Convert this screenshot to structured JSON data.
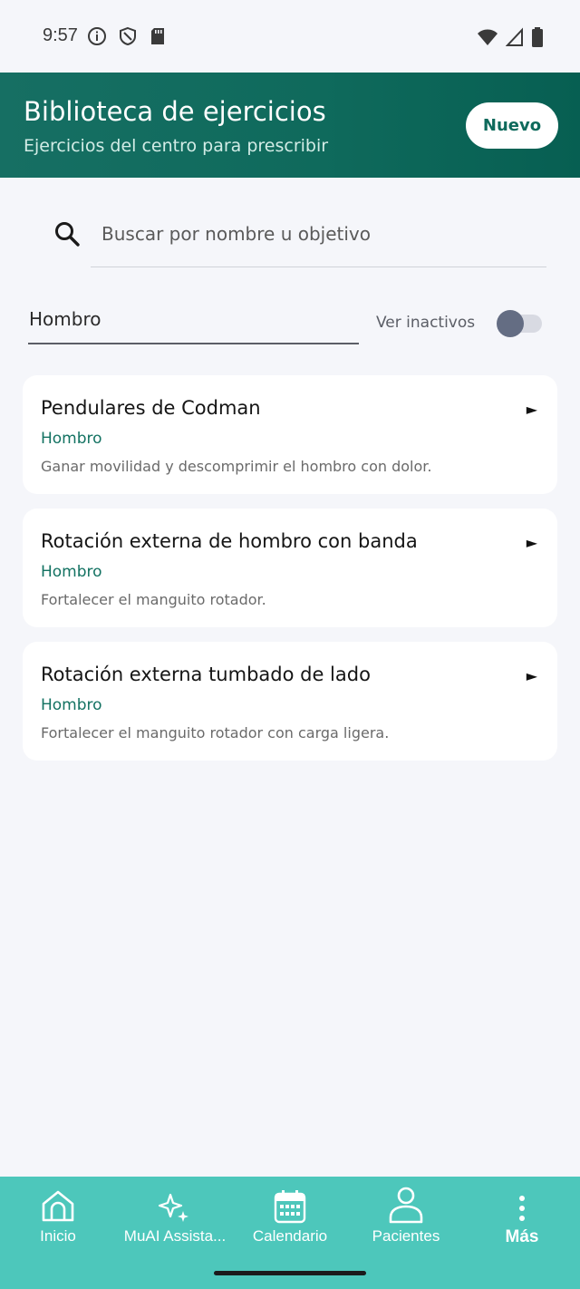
{
  "status_bar": {
    "time": "9:57",
    "left_icons": [
      "info-icon",
      "shield-icon",
      "sd-card-icon"
    ],
    "right_icons": [
      "wifi-icon",
      "signal-icon",
      "battery-icon"
    ]
  },
  "header": {
    "title": "Biblioteca de ejercicios",
    "subtitle": "Ejercicios del centro para prescribir",
    "new_button_label": "Nuevo",
    "color": "#0f6a5c"
  },
  "search": {
    "placeholder": "Buscar por nombre u objetivo",
    "value": ""
  },
  "filter": {
    "value": "Hombro",
    "inactive_label": "Ver inactivos",
    "inactive_toggle_on": false
  },
  "exercises": [
    {
      "title": "Pendulares de Codman",
      "tag": "Hombro",
      "description": "Ganar movilidad y descomprimir el hombro con dolor.",
      "arrow": "►"
    },
    {
      "title": "Rotación externa de hombro con banda",
      "tag": "Hombro",
      "description": "Fortalecer el manguito rotador.",
      "arrow": "►"
    },
    {
      "title": "Rotación externa tumbado de lado",
      "tag": "Hombro",
      "description": "Fortalecer el manguito rotador con carga ligera.",
      "arrow": "►"
    }
  ],
  "bottom_nav": {
    "items": [
      {
        "label": "Inicio",
        "icon": "home-icon"
      },
      {
        "label": "MuAI Assista...",
        "icon": "sparkle-icon"
      },
      {
        "label": "Calendario",
        "icon": "calendar-icon"
      },
      {
        "label": "Pacientes",
        "icon": "person-icon"
      },
      {
        "label": "Más",
        "icon": "more-vertical-icon",
        "active": true
      }
    ],
    "background": "#4dc7bb"
  }
}
